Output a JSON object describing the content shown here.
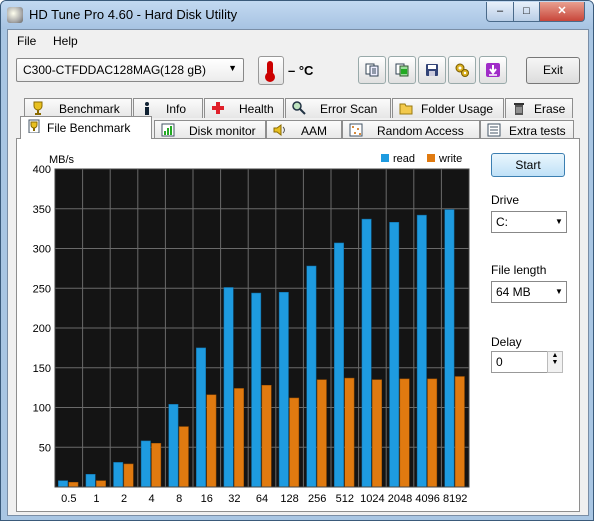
{
  "window": {
    "title": "HD Tune Pro 4.60 - Hard Disk Utility",
    "minimize": "‒",
    "maximize": "□",
    "close": "✕"
  },
  "menu": {
    "file": "File",
    "help": "Help"
  },
  "toolbar": {
    "drive": "C300-CTFDDAC128MAG",
    "drive_size": "(128 gB)",
    "temperature": "– °C",
    "exit_label": "Exit",
    "icons": [
      "copy-text-icon",
      "copy-screenshot-icon",
      "save-icon",
      "options-gears-icon",
      "download-icon"
    ]
  },
  "tabs_row1": [
    {
      "label": "Benchmark",
      "icon": "benchmark-icon"
    },
    {
      "label": "Info",
      "icon": "info-icon"
    },
    {
      "label": "Health",
      "icon": "health-cross-icon"
    },
    {
      "label": "Error Scan",
      "icon": "magnifier-icon"
    },
    {
      "label": "Folder Usage",
      "icon": "folder-icon"
    },
    {
      "label": "Erase",
      "icon": "trash-icon"
    }
  ],
  "tabs_row2": [
    {
      "label": "File Benchmark",
      "icon": "file-benchmark-icon",
      "active": true
    },
    {
      "label": "Disk monitor",
      "icon": "monitor-chart-icon"
    },
    {
      "label": "AAM",
      "icon": "speaker-icon"
    },
    {
      "label": "Random Access",
      "icon": "random-access-icon"
    },
    {
      "label": "Extra tests",
      "icon": "extra-tests-icon"
    }
  ],
  "side": {
    "start_label": "Start",
    "drive_label": "Drive",
    "drive_value": "C:",
    "file_length_label": "File length",
    "file_length_value": "64 MB",
    "delay_label": "Delay",
    "delay_value": "0"
  },
  "chart_data": {
    "type": "bar",
    "ylabel": "MB/s",
    "ylim": [
      0,
      400
    ],
    "yticks": [
      50,
      100,
      150,
      200,
      250,
      300,
      350,
      400
    ],
    "categories": [
      "0.5",
      "1",
      "2",
      "4",
      "8",
      "16",
      "32",
      "64",
      "128",
      "256",
      "512",
      "1024",
      "2048",
      "4096",
      "8192"
    ],
    "series": [
      {
        "name": "read",
        "color": "#1e9be0",
        "values": [
          8,
          16,
          31,
          58,
          104,
          175,
          251,
          244,
          245,
          278,
          307,
          337,
          333,
          342,
          349
        ]
      },
      {
        "name": "write",
        "color": "#e07a10",
        "values": [
          6,
          8,
          29,
          55,
          76,
          116,
          124,
          128,
          112,
          135,
          137,
          135,
          136,
          136,
          139
        ]
      }
    ],
    "legend_position": "top-right",
    "grid": true,
    "plot_background": "#141414"
  }
}
